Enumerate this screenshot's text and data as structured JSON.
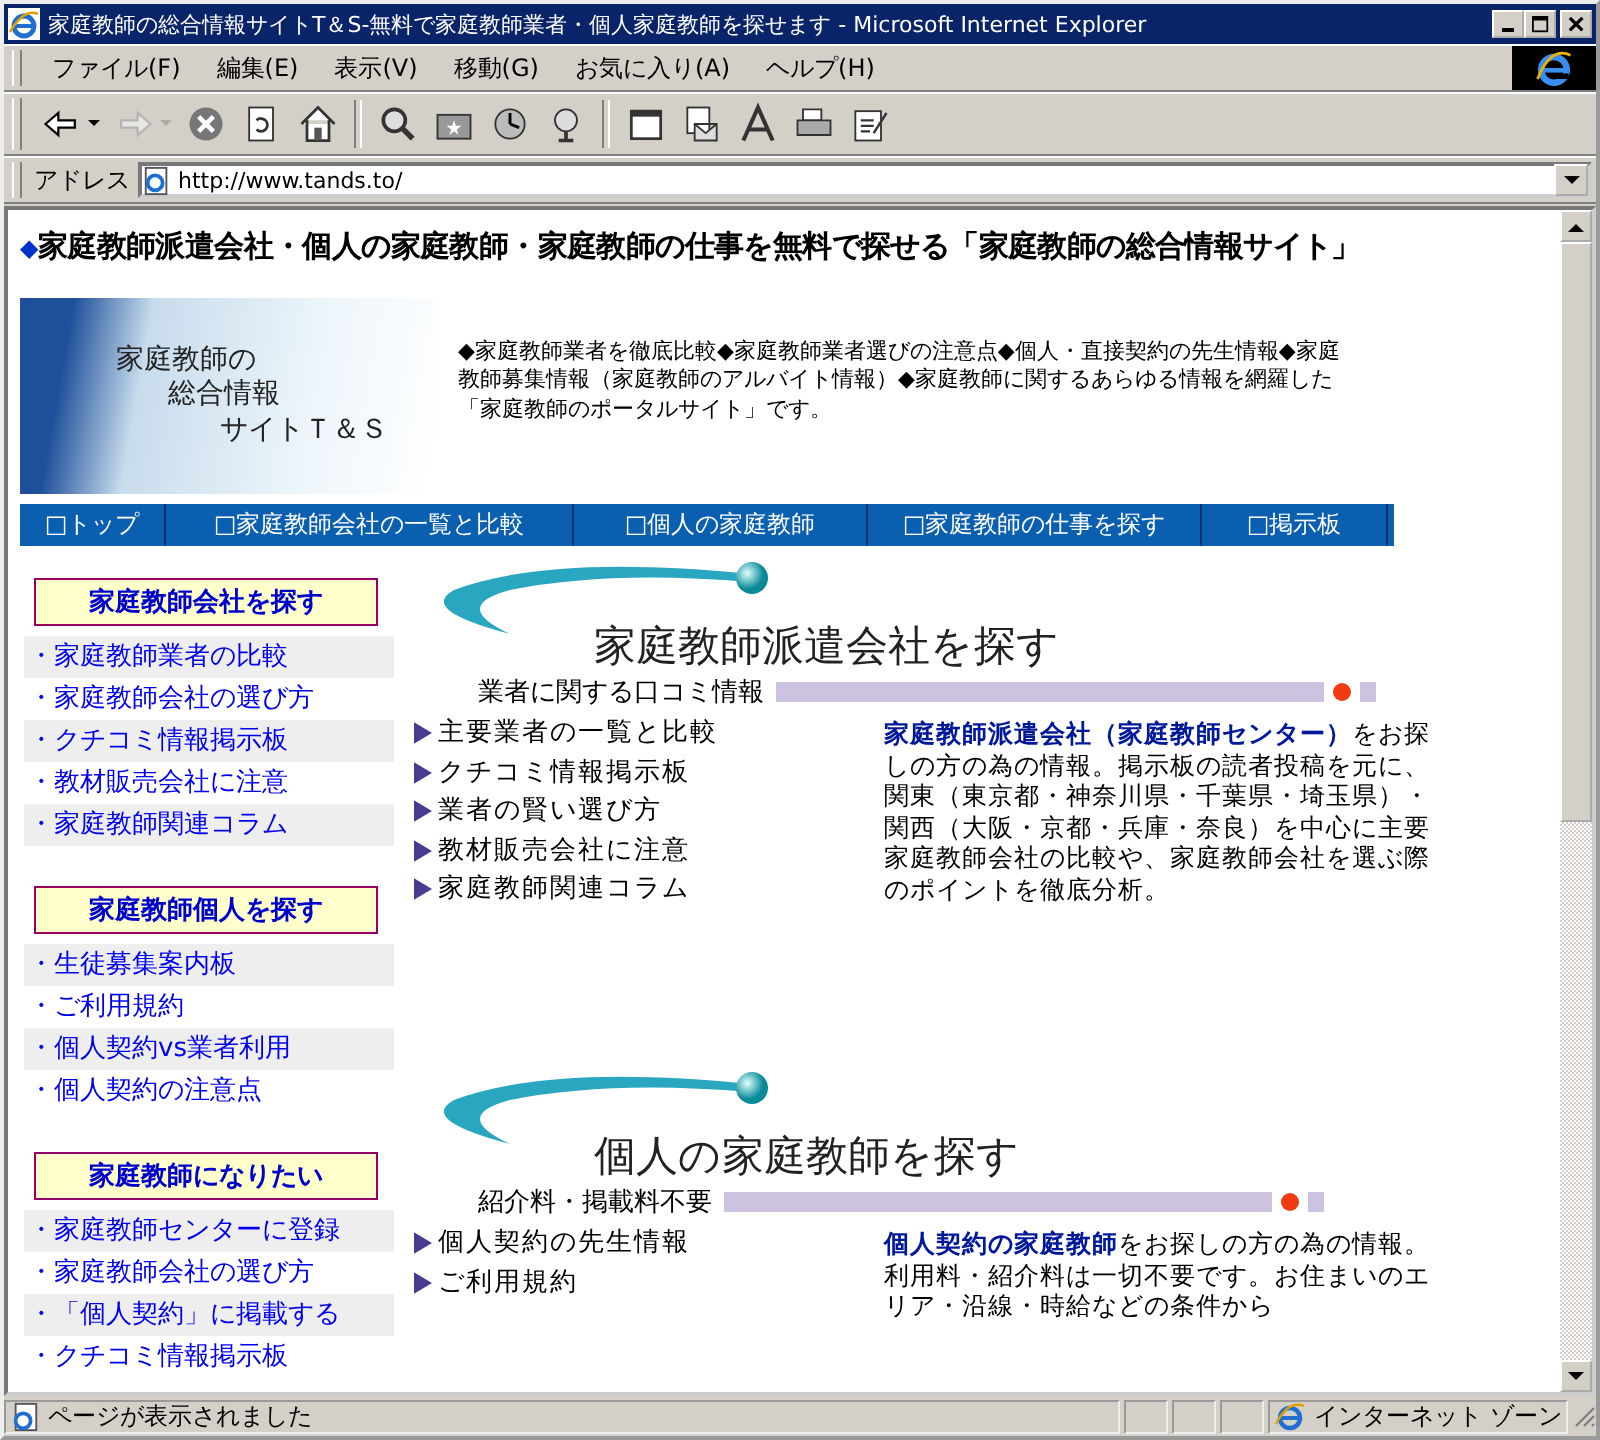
{
  "window": {
    "title": "家庭教師の総合情報サイトT＆S-無料で家庭教師業者・個人家庭教師を探せます - Microsoft Internet Explorer"
  },
  "menu": [
    "ファイル(F)",
    "編集(E)",
    "表示(V)",
    "移動(G)",
    "お気に入り(A)",
    "ヘルプ(H)"
  ],
  "toolbar": [
    {
      "kind": "back",
      "disabled": false
    },
    {
      "kind": "forward",
      "disabled": true
    },
    {
      "kind": "stop",
      "disabled": false
    },
    {
      "kind": "refresh",
      "disabled": false
    },
    {
      "kind": "home",
      "disabled": false
    },
    {
      "kind": "separator"
    },
    {
      "kind": "search",
      "disabled": false
    },
    {
      "kind": "favorites",
      "disabled": false
    },
    {
      "kind": "history",
      "disabled": false
    },
    {
      "kind": "channels",
      "disabled": false
    },
    {
      "kind": "separator"
    },
    {
      "kind": "fullscreen",
      "disabled": false
    },
    {
      "kind": "mail",
      "disabled": false
    },
    {
      "kind": "font",
      "disabled": false
    },
    {
      "kind": "print",
      "disabled": false
    },
    {
      "kind": "edit",
      "disabled": false
    }
  ],
  "address": {
    "label": "アドレス",
    "url": "http://www.tands.to/"
  },
  "page": {
    "heading_mark": "◆",
    "heading": "家庭教師派遣会社・個人の家庭教師・家庭教師の仕事を無料で探せる「家庭教師の総合情報サイト」",
    "logo_lines": [
      "家庭教師の",
      "総合情報",
      "サイトＴ＆Ｓ"
    ],
    "intro": "◆家庭教師業者を徹底比較◆家庭教師業者選びの注意点◆個人・直接契約の先生情報◆家庭教師募集情報（家庭教師のアルバイト情報）◆家庭教師に関するあらゆる情報を網羅した「家庭教師のポータルサイト」です。",
    "nav": [
      "□トップ",
      "□家庭教師会社の一覧と比較",
      "□個人の家庭教師",
      "□家庭教師の仕事を探す",
      "□掲示板"
    ],
    "sidebar": [
      {
        "title": "家庭教師会社を探す",
        "items": [
          "・家庭教師業者の比較",
          "・家庭教師会社の選び方",
          "・クチコミ情報掲示板",
          "・教材販売会社に注意",
          "・家庭教師関連コラム"
        ]
      },
      {
        "title": "家庭教師個人を探す",
        "items": [
          "・生徒募集案内板",
          "・ご利用規約",
          "・個人契約vs業者利用",
          "・個人契約の注意点"
        ]
      },
      {
        "title": "家庭教師になりたい",
        "items": [
          "・家庭教師センターに登録",
          "・家庭教師会社の選び方",
          "・「個人契約」に掲載する",
          "・クチコミ情報掲示板"
        ]
      }
    ],
    "sections": [
      {
        "title": "家庭教師派遣会社を探す",
        "subtitle": "業者に関する口コミ情報",
        "links": [
          "主要業者の一覧と比較",
          "クチコミ情報掲示板",
          "業者の賢い選び方",
          "教材販売会社に注意",
          "家庭教師関連コラム"
        ],
        "lead": "家庭教師派遣会社（家庭教師センター）",
        "text": "をお探しの方の為の情報。掲示板の読者投稿を元に、関東（東京都・神奈川県・千葉県・埼玉県）・関西（大阪・京都・兵庫・奈良）を中心に主要家庭教師会社の比較や、家庭教師会社を選ぶ際のポイントを徹底分析。"
      },
      {
        "title": "個人の家庭教師を探す",
        "subtitle": "紹介料・掲載料不要",
        "links": [
          "個人契約の先生情報",
          "ご利用規約"
        ],
        "lead": "個人契約の家庭教師",
        "text": "をお探しの方の為の情報。利用料・紹介料は一切不要です。お住まいのエリア・沿線・時給などの条件から"
      }
    ]
  },
  "status_bar": {
    "text": "ページが表示されました",
    "zone": "インターネット ゾーン"
  }
}
